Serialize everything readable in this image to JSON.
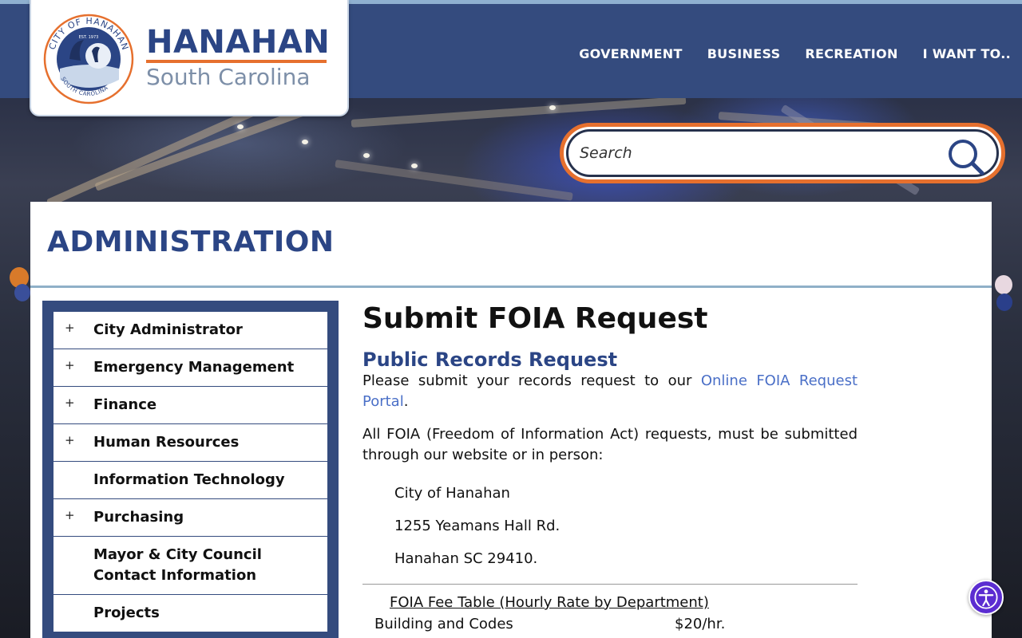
{
  "brand": {
    "name": "HANAHAN",
    "subtitle": "South Carolina",
    "seal_text_top": "CITY OF HANAHAN",
    "seal_text_bottom": "SOUTH CAROLINA",
    "seal_est": "EST. 1973"
  },
  "nav": {
    "items": [
      {
        "label": "GOVERNMENT"
      },
      {
        "label": "BUSINESS"
      },
      {
        "label": "RECREATION"
      },
      {
        "label": "I WANT TO.."
      }
    ]
  },
  "search": {
    "placeholder": "Search",
    "icon": "search-icon"
  },
  "section": {
    "title": "ADMINISTRATION"
  },
  "sidebar": {
    "items": [
      {
        "label": "City Administrator",
        "expandable": "+"
      },
      {
        "label": "Emergency Management",
        "expandable": "+"
      },
      {
        "label": "Finance",
        "expandable": "+"
      },
      {
        "label": "Human Resources",
        "expandable": "+"
      },
      {
        "label": "Information Technology",
        "expandable": ""
      },
      {
        "label": "Purchasing",
        "expandable": "+"
      },
      {
        "label": "Mayor & City Council Contact Information",
        "expandable": ""
      },
      {
        "label": "Projects",
        "expandable": ""
      }
    ]
  },
  "article": {
    "heading": "Submit FOIA Request",
    "subheading": "Public Records Request",
    "para1_prefix": "Please submit your records request to our ",
    "para1_link": "Online FOIA Request Portal",
    "para1_suffix": ".",
    "para2": "All FOIA (Freedom of Information Act) requests, must be submitted through our website or in person:",
    "address": [
      "City of Hanahan",
      "1255 Yeamans Hall Rd.",
      "Hanahan SC 29410."
    ],
    "fee_table_title": "FOIA Fee Table (Hourly Rate by Department)",
    "fee_rows": [
      {
        "department": "Building and Codes",
        "rate": "$20/hr."
      }
    ]
  },
  "colors": {
    "brand_blue": "#2b4585",
    "header_bg": "#344b7e",
    "accent_orange": "#e6702e",
    "link": "#4a6fc7",
    "a11y_purple": "#5b2dd1"
  },
  "accessibility": {
    "icon": "accessibility-icon"
  }
}
